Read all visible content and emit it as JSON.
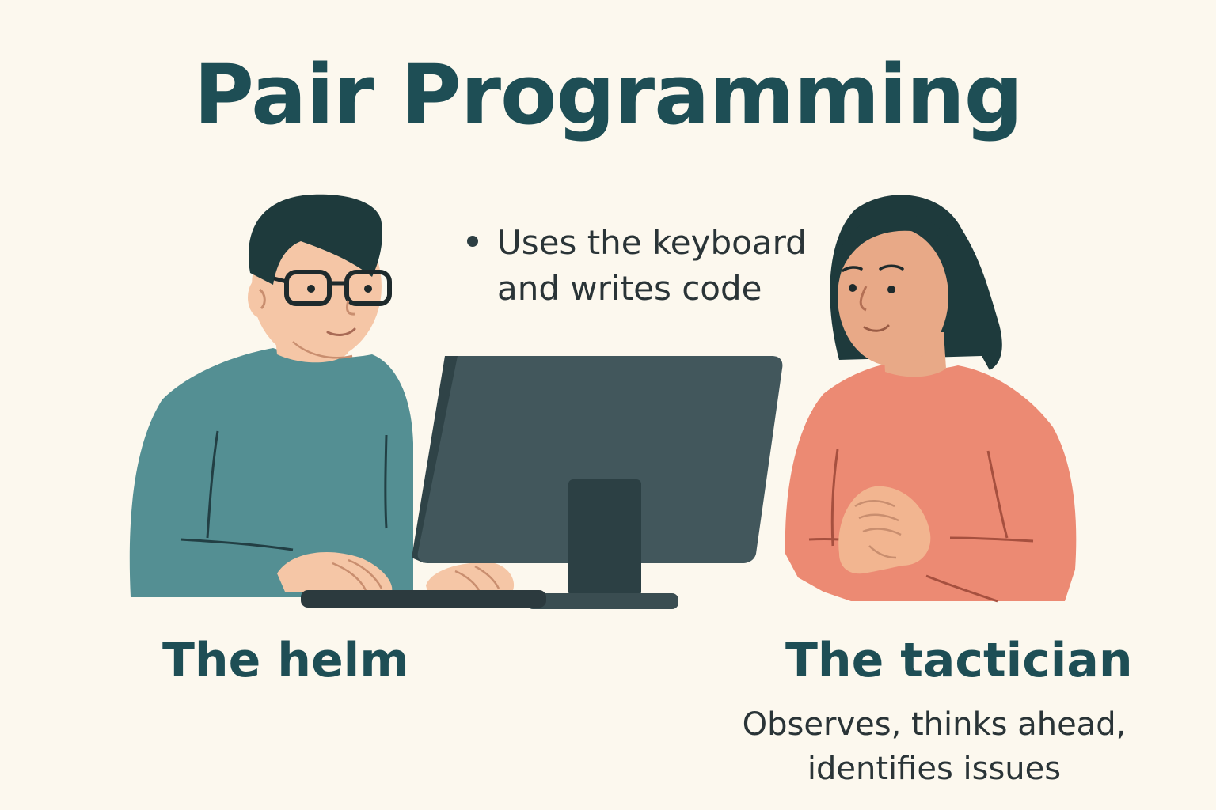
{
  "title": "Pair Programming",
  "driver": {
    "label": "The helm",
    "description_line1": "Uses the keyboard",
    "description_line2": "and writes code"
  },
  "navigator": {
    "label": "The tactician",
    "description_line1": "Observes, thinks ahead,",
    "description_line2": "identifies issues"
  },
  "colors": {
    "background": "#fcf8ee",
    "title": "#1e4e55",
    "driver_shirt": "#548f93",
    "navigator_shirt": "#ec8a73",
    "monitor": "#42575c",
    "hair": "#1e3a3c",
    "skin_light": "#f5c6a6",
    "skin_tan": "#e8a987"
  }
}
